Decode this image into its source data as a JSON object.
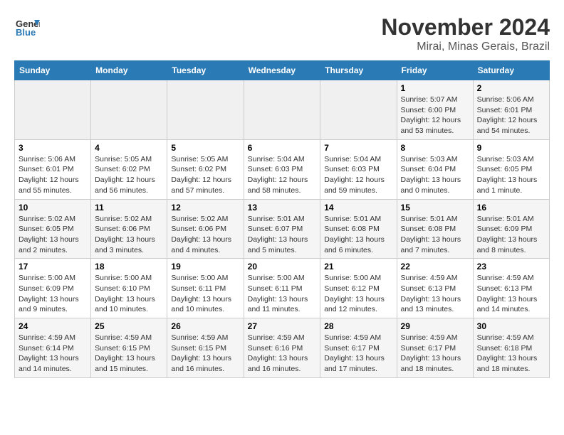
{
  "header": {
    "logo_line1": "General",
    "logo_line2": "Blue",
    "month": "November 2024",
    "location": "Mirai, Minas Gerais, Brazil"
  },
  "days_of_week": [
    "Sunday",
    "Monday",
    "Tuesday",
    "Wednesday",
    "Thursday",
    "Friday",
    "Saturday"
  ],
  "weeks": [
    [
      {
        "day": "",
        "info": ""
      },
      {
        "day": "",
        "info": ""
      },
      {
        "day": "",
        "info": ""
      },
      {
        "day": "",
        "info": ""
      },
      {
        "day": "",
        "info": ""
      },
      {
        "day": "1",
        "info": "Sunrise: 5:07 AM\nSunset: 6:00 PM\nDaylight: 12 hours and 53 minutes."
      },
      {
        "day": "2",
        "info": "Sunrise: 5:06 AM\nSunset: 6:01 PM\nDaylight: 12 hours and 54 minutes."
      }
    ],
    [
      {
        "day": "3",
        "info": "Sunrise: 5:06 AM\nSunset: 6:01 PM\nDaylight: 12 hours and 55 minutes."
      },
      {
        "day": "4",
        "info": "Sunrise: 5:05 AM\nSunset: 6:02 PM\nDaylight: 12 hours and 56 minutes."
      },
      {
        "day": "5",
        "info": "Sunrise: 5:05 AM\nSunset: 6:02 PM\nDaylight: 12 hours and 57 minutes."
      },
      {
        "day": "6",
        "info": "Sunrise: 5:04 AM\nSunset: 6:03 PM\nDaylight: 12 hours and 58 minutes."
      },
      {
        "day": "7",
        "info": "Sunrise: 5:04 AM\nSunset: 6:03 PM\nDaylight: 12 hours and 59 minutes."
      },
      {
        "day": "8",
        "info": "Sunrise: 5:03 AM\nSunset: 6:04 PM\nDaylight: 13 hours and 0 minutes."
      },
      {
        "day": "9",
        "info": "Sunrise: 5:03 AM\nSunset: 6:05 PM\nDaylight: 13 hours and 1 minute."
      }
    ],
    [
      {
        "day": "10",
        "info": "Sunrise: 5:02 AM\nSunset: 6:05 PM\nDaylight: 13 hours and 2 minutes."
      },
      {
        "day": "11",
        "info": "Sunrise: 5:02 AM\nSunset: 6:06 PM\nDaylight: 13 hours and 3 minutes."
      },
      {
        "day": "12",
        "info": "Sunrise: 5:02 AM\nSunset: 6:06 PM\nDaylight: 13 hours and 4 minutes."
      },
      {
        "day": "13",
        "info": "Sunrise: 5:01 AM\nSunset: 6:07 PM\nDaylight: 13 hours and 5 minutes."
      },
      {
        "day": "14",
        "info": "Sunrise: 5:01 AM\nSunset: 6:08 PM\nDaylight: 13 hours and 6 minutes."
      },
      {
        "day": "15",
        "info": "Sunrise: 5:01 AM\nSunset: 6:08 PM\nDaylight: 13 hours and 7 minutes."
      },
      {
        "day": "16",
        "info": "Sunrise: 5:01 AM\nSunset: 6:09 PM\nDaylight: 13 hours and 8 minutes."
      }
    ],
    [
      {
        "day": "17",
        "info": "Sunrise: 5:00 AM\nSunset: 6:09 PM\nDaylight: 13 hours and 9 minutes."
      },
      {
        "day": "18",
        "info": "Sunrise: 5:00 AM\nSunset: 6:10 PM\nDaylight: 13 hours and 10 minutes."
      },
      {
        "day": "19",
        "info": "Sunrise: 5:00 AM\nSunset: 6:11 PM\nDaylight: 13 hours and 10 minutes."
      },
      {
        "day": "20",
        "info": "Sunrise: 5:00 AM\nSunset: 6:11 PM\nDaylight: 13 hours and 11 minutes."
      },
      {
        "day": "21",
        "info": "Sunrise: 5:00 AM\nSunset: 6:12 PM\nDaylight: 13 hours and 12 minutes."
      },
      {
        "day": "22",
        "info": "Sunrise: 4:59 AM\nSunset: 6:13 PM\nDaylight: 13 hours and 13 minutes."
      },
      {
        "day": "23",
        "info": "Sunrise: 4:59 AM\nSunset: 6:13 PM\nDaylight: 13 hours and 14 minutes."
      }
    ],
    [
      {
        "day": "24",
        "info": "Sunrise: 4:59 AM\nSunset: 6:14 PM\nDaylight: 13 hours and 14 minutes."
      },
      {
        "day": "25",
        "info": "Sunrise: 4:59 AM\nSunset: 6:15 PM\nDaylight: 13 hours and 15 minutes."
      },
      {
        "day": "26",
        "info": "Sunrise: 4:59 AM\nSunset: 6:15 PM\nDaylight: 13 hours and 16 minutes."
      },
      {
        "day": "27",
        "info": "Sunrise: 4:59 AM\nSunset: 6:16 PM\nDaylight: 13 hours and 16 minutes."
      },
      {
        "day": "28",
        "info": "Sunrise: 4:59 AM\nSunset: 6:17 PM\nDaylight: 13 hours and 17 minutes."
      },
      {
        "day": "29",
        "info": "Sunrise: 4:59 AM\nSunset: 6:17 PM\nDaylight: 13 hours and 18 minutes."
      },
      {
        "day": "30",
        "info": "Sunrise: 4:59 AM\nSunset: 6:18 PM\nDaylight: 13 hours and 18 minutes."
      }
    ]
  ]
}
